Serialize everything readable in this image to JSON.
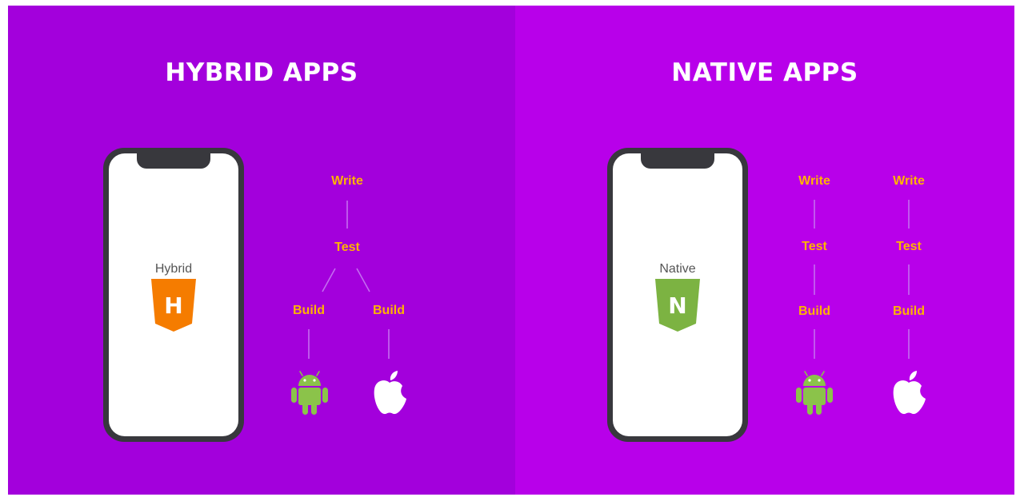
{
  "colors": {
    "hybrid_bg": "#a300dc",
    "native_bg": "#b800ea",
    "step_text": "#ffb300",
    "connector": "#c46cf0",
    "hybrid_badge": "#f57c00",
    "native_badge": "#7cb342",
    "android_green": "#8bc34a",
    "phone_frame": "#38383d"
  },
  "hybrid": {
    "title": "HYBRID APPS",
    "app_label": "Hybrid",
    "badge_letter": "H",
    "steps": {
      "write": "Write",
      "test": "Test",
      "build_android": "Build",
      "build_ios": "Build"
    },
    "icons": [
      "android-icon",
      "apple-icon"
    ]
  },
  "native": {
    "title": "NATIVE APPS",
    "app_label": "Native",
    "badge_letter": "N",
    "android_column": {
      "write": "Write",
      "test": "Test",
      "build": "Build"
    },
    "ios_column": {
      "write": "Write",
      "test": "Test",
      "build": "Build"
    },
    "icons": [
      "android-icon",
      "apple-icon"
    ]
  }
}
